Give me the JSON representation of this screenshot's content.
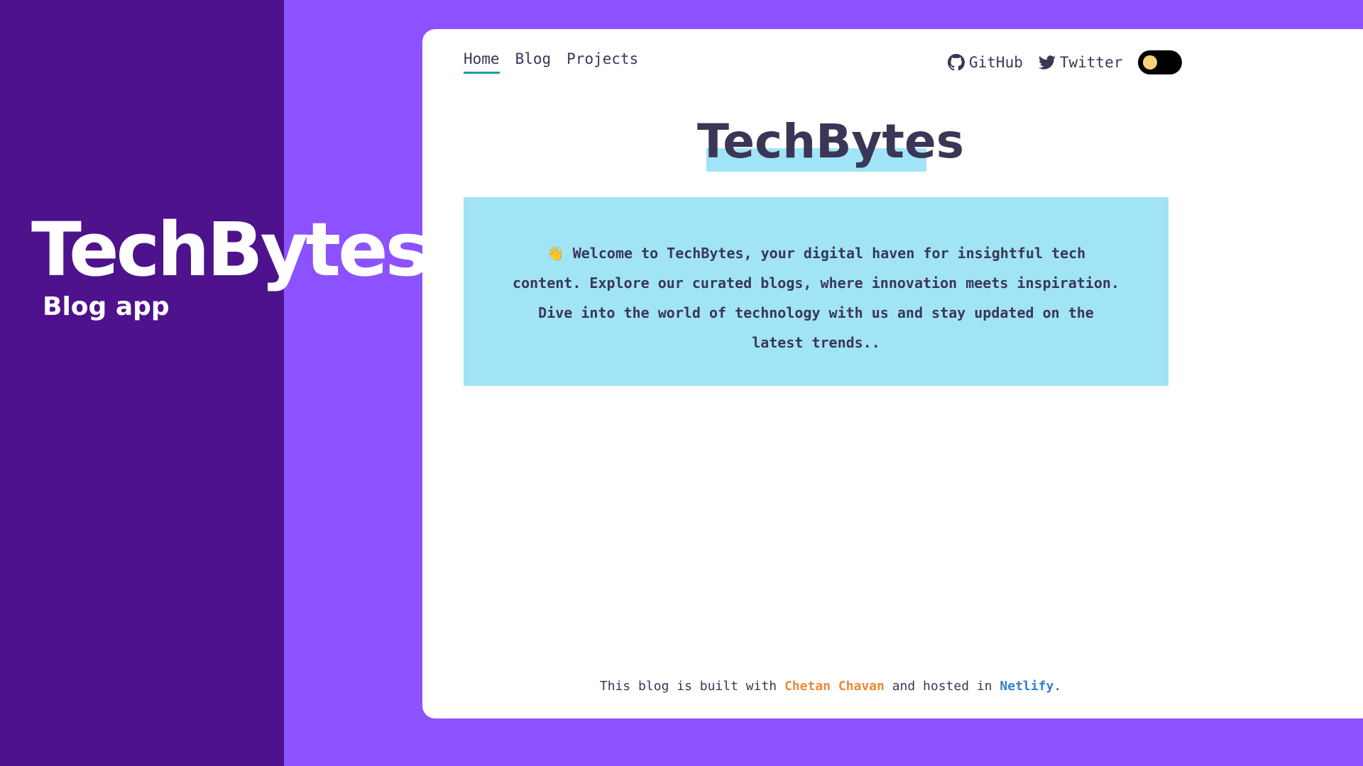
{
  "colors": {
    "background": "#8c52ff",
    "left_panel": "#4d128c",
    "window": "#ffffff",
    "highlight": "#a1e4f6",
    "text": "#3b3656",
    "author_link": "#ed8936",
    "host_link": "#3182ce",
    "toggle_track": "#000000",
    "toggle_knob": "#f6d27a"
  },
  "brand": {
    "title": "TechBytes",
    "subtitle": "Blog app"
  },
  "nav": {
    "items": [
      {
        "label": "Home",
        "active": true
      },
      {
        "label": "Blog",
        "active": false
      },
      {
        "label": "Projects",
        "active": false
      }
    ],
    "github_label": "GitHub",
    "github_icon": "github-icon",
    "twitter_label": "Twitter",
    "twitter_icon": "twitter-icon",
    "theme_toggle": "light"
  },
  "main": {
    "title": "TechBytes",
    "welcome_emoji": "👋",
    "welcome_text": "Welcome to TechBytes, your digital haven for insightful tech content. Explore our curated blogs, where innovation meets inspiration. Dive into the world of technology with us and stay updated on the latest trends.."
  },
  "footer": {
    "prefix": "This blog is built with ",
    "author": "Chetan Chavan",
    "middle": " and hosted in ",
    "host": "Netlify",
    "suffix": "."
  }
}
